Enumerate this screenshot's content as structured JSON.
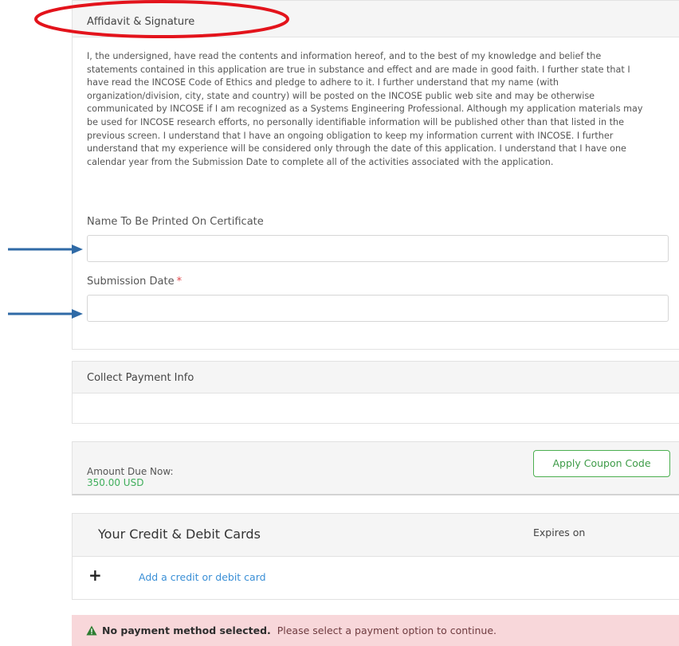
{
  "affidavit": {
    "header": "Affidavit & Signature",
    "text": "I, the undersigned, have read the contents and information hereof, and to the best of my knowledge and belief the statements contained in this application are true in substance and effect and are made in good faith. I further state that I have read the INCOSE Code of Ethics and pledge to adhere to it. I further understand that my name (with organization/division, city, state and country) will be posted on the INCOSE public web site and may be otherwise communicated by INCOSE if I am recognized as a Systems Engineering Professional. Although my application materials may be used for INCOSE research efforts, no personally identifiable information will be published other than that listed in the previous screen. I understand that I have an ongoing obligation to keep my information current with INCOSE. I further understand that my experience will be considered only through the date of this application. I understand that I have one calendar year from the Submission Date to complete all of the activities associated with the application.",
    "name_label": "Name To Be Printed On Certificate",
    "name_value": "",
    "date_label": "Submission Date",
    "date_required_mark": "*",
    "date_value": ""
  },
  "payment": {
    "header": "Collect Payment Info",
    "amount_label": "Amount Due Now:",
    "amount_value": "350.00 USD",
    "coupon_button": "Apply Coupon Code"
  },
  "cards": {
    "title": "Your Credit & Debit Cards",
    "expires_label": "Expires on",
    "add_symbol": "+",
    "add_link": "Add a credit or debit card"
  },
  "alert": {
    "bold": "No payment method selected.",
    "message": "Please select a payment option to continue."
  },
  "colors": {
    "annotation_red": "#e3131b",
    "annotation_arrow": "#2f6aa6",
    "success_green": "#3fae5b",
    "link_blue": "#3a8fd6",
    "alert_bg": "#f8d7da",
    "required_red": "#e0474c"
  },
  "icons": {
    "alert": "warning-triangle-icon",
    "add": "plus-icon"
  }
}
